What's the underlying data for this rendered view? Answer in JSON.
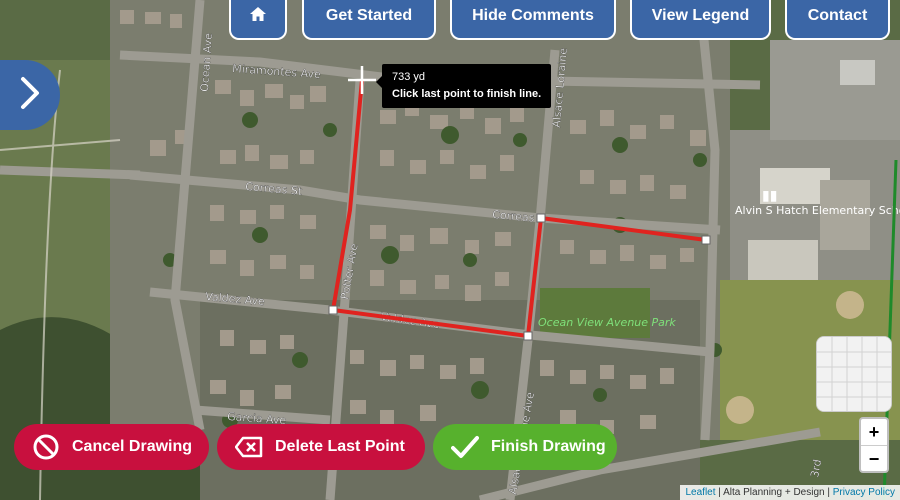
{
  "nav": {
    "home_icon": "home-icon",
    "get_started": "Get Started",
    "hide_comments": "Hide Comments",
    "view_legend": "View Legend",
    "contact": "Contact"
  },
  "sidebar_toggle_icon": "chevron-right-icon",
  "tooltip": {
    "distance": "733 yd",
    "hint": "Click last point to finish line."
  },
  "map_labels": {
    "miramontes": "Miramontes Ave",
    "ocean": "Ocean Ave",
    "correas_st": "Correas St",
    "correas": "Correas",
    "alsace": "Alsace Loraine",
    "valdez_ave": "Valdez Ave",
    "valdez": "Valdez Ave",
    "potter": "Potter Ave",
    "garcia": "Garcia Ave",
    "alsace_lower": "Alsace Loraine Ave",
    "school": "Alvin S Hatch Elementary School",
    "park": "Ocean View Avenue Park",
    "third": "3rd"
  },
  "actions": {
    "cancel": "Cancel Drawing",
    "delete_last": "Delete Last Point",
    "finish": "Finish Drawing"
  },
  "zoom": {
    "in": "+",
    "out": "−"
  },
  "attribution": {
    "leaflet": "Leaflet",
    "sep1": " | ",
    "alta": "Alta Planning + Design",
    "sep2": " | ",
    "privacy": "Privacy Policy"
  },
  "colors": {
    "nav_blue": "#3b66a6",
    "route_red": "#e0231f",
    "cancel_red": "#c8103e",
    "finish_green": "#57b12d"
  }
}
